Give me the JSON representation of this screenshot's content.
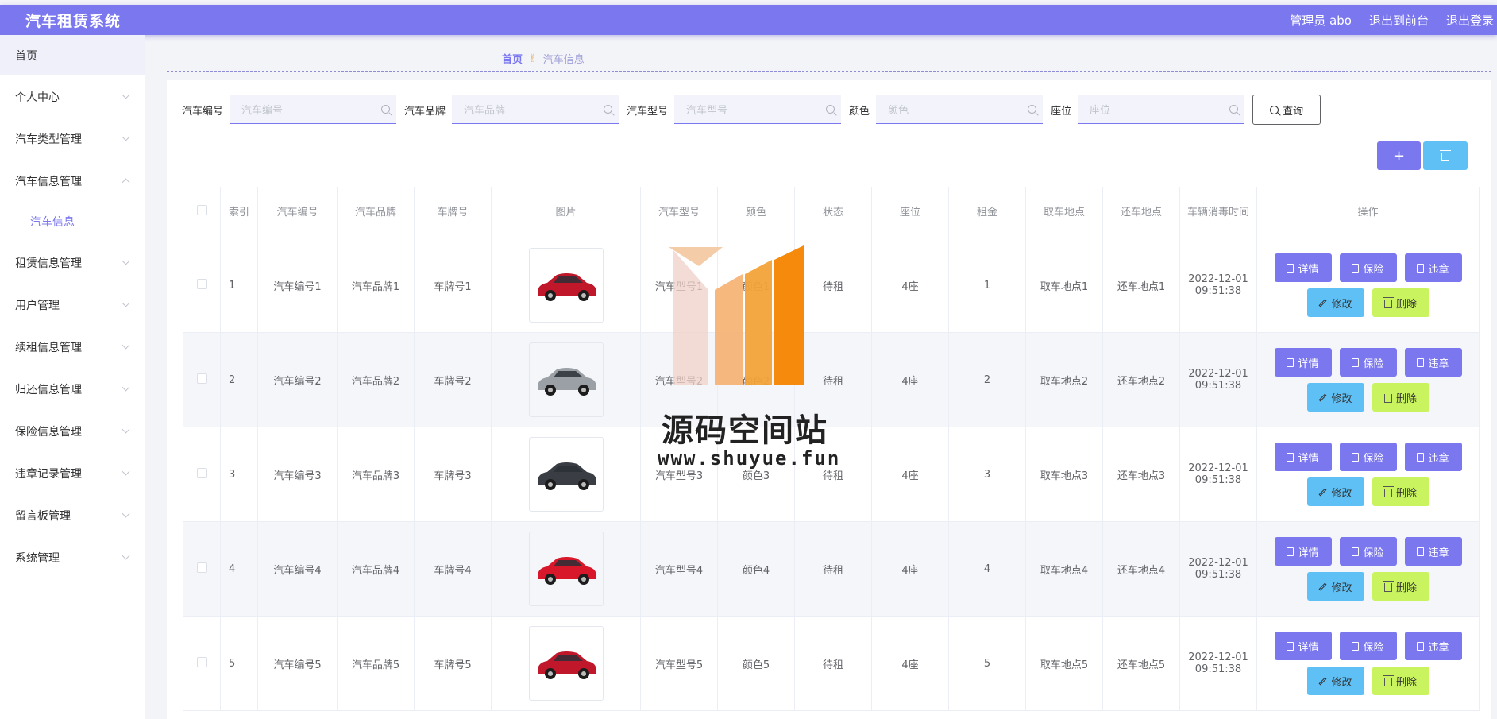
{
  "header": {
    "title": "汽车租赁系统",
    "admin_label": "管理员 abo",
    "to_front_label": "退出到前台",
    "logout_label": "退出登录"
  },
  "sidebar": {
    "items": [
      {
        "label": "首页",
        "expanded": null
      },
      {
        "label": "个人中心",
        "expanded": false
      },
      {
        "label": "汽车类型管理",
        "expanded": false
      },
      {
        "label": "汽车信息管理",
        "expanded": true
      },
      {
        "label": "租赁信息管理",
        "expanded": false
      },
      {
        "label": "用户管理",
        "expanded": false
      },
      {
        "label": "续租信息管理",
        "expanded": false
      },
      {
        "label": "归还信息管理",
        "expanded": false
      },
      {
        "label": "保险信息管理",
        "expanded": false
      },
      {
        "label": "违章记录管理",
        "expanded": false
      },
      {
        "label": "留言板管理",
        "expanded": false
      },
      {
        "label": "系统管理",
        "expanded": false
      }
    ],
    "subitem": "汽车信息"
  },
  "breadcrumb": {
    "home": "首页",
    "current": "汽车信息"
  },
  "search": {
    "fields": [
      {
        "label": "汽车编号",
        "placeholder": "汽车编号"
      },
      {
        "label": "汽车品牌",
        "placeholder": "汽车品牌"
      },
      {
        "label": "汽车型号",
        "placeholder": "汽车型号"
      },
      {
        "label": "颜色",
        "placeholder": "颜色"
      },
      {
        "label": "座位",
        "placeholder": "座位"
      }
    ],
    "query_label": "查询"
  },
  "toolbar": {
    "add_label": "+"
  },
  "table": {
    "columns": [
      "索引",
      "汽车编号",
      "汽车品牌",
      "车牌号",
      "图片",
      "汽车型号",
      "颜色",
      "状态",
      "座位",
      "租金",
      "取车地点",
      "还车地点",
      "车辆消毒时间",
      "操作"
    ],
    "rows": [
      {
        "index": "1",
        "code": "汽车编号1",
        "brand": "汽车品牌1",
        "plate": "车牌号1",
        "model": "汽车型号1",
        "color": "颜色1",
        "status": "待租",
        "seats": "4座",
        "rent": "1",
        "pickup": "取车地点1",
        "return": "还车地点1",
        "date": "2022-12-01",
        "time": "09:51:38",
        "car_color": "#c0182a"
      },
      {
        "index": "2",
        "code": "汽车编号2",
        "brand": "汽车品牌2",
        "plate": "车牌号2",
        "model": "汽车型号2",
        "color": "颜色2",
        "status": "待租",
        "seats": "4座",
        "rent": "2",
        "pickup": "取车地点2",
        "return": "还车地点2",
        "date": "2022-12-01",
        "time": "09:51:38",
        "car_color": "#9aa0a6"
      },
      {
        "index": "3",
        "code": "汽车编号3",
        "brand": "汽车品牌3",
        "plate": "车牌号3",
        "model": "汽车型号3",
        "color": "颜色3",
        "status": "待租",
        "seats": "4座",
        "rent": "3",
        "pickup": "取车地点3",
        "return": "还车地点3",
        "date": "2022-12-01",
        "time": "09:51:38",
        "car_color": "#3a3d44"
      },
      {
        "index": "4",
        "code": "汽车编号4",
        "brand": "汽车品牌4",
        "plate": "车牌号4",
        "model": "汽车型号4",
        "color": "颜色4",
        "status": "待租",
        "seats": "4座",
        "rent": "4",
        "pickup": "取车地点4",
        "return": "还车地点4",
        "date": "2022-12-01",
        "time": "09:51:38",
        "car_color": "#d8182a"
      },
      {
        "index": "5",
        "code": "汽车编号5",
        "brand": "汽车品牌5",
        "plate": "车牌号5",
        "model": "汽车型号5",
        "color": "颜色5",
        "status": "待租",
        "seats": "4座",
        "rent": "5",
        "pickup": "取车地点5",
        "return": "还车地点5",
        "date": "2022-12-01",
        "time": "09:51:38",
        "car_color": "#c0182a"
      }
    ],
    "actions": {
      "detail": "详情",
      "insurance": "保险",
      "violation": "违章",
      "edit": "修改",
      "delete": "删除"
    }
  },
  "watermark": {
    "title": "源码空间站",
    "url": "www.shuyue.fun"
  },
  "colors": {
    "accent": "#7b78ef",
    "info": "#5fc0f5",
    "lime": "#c9f35f"
  }
}
